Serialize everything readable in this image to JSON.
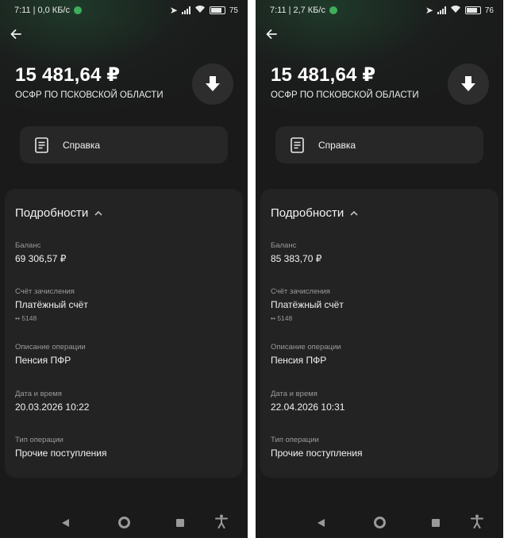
{
  "screens": [
    {
      "status": {
        "time": "7:11",
        "net": "0,0 КБ/с",
        "battery": "75"
      },
      "amount": "15 481,64 ₽",
      "payer": "ОСФР ПО ПСКОВСКОЙ ОБЛАСТИ",
      "spravka_label": "Справка",
      "details": {
        "title": "Подробности",
        "balance_label": "Баланс",
        "balance_value": "69 306,57 ₽",
        "account_label": "Счёт зачисления",
        "account_value": "Платёжный счёт",
        "account_number": "•• 5148",
        "description_label": "Описание операции",
        "description_value": "Пенсия ПФР",
        "datetime_label": "Дата и время",
        "datetime_value": "20.03.2026 10:22",
        "type_label": "Тип операции",
        "type_value": "Прочие поступления"
      }
    },
    {
      "status": {
        "time": "7:11",
        "net": "2,7 КБ/с",
        "battery": "76"
      },
      "amount": "15 481,64 ₽",
      "payer": "ОСФР ПО ПСКОВСКОЙ ОБЛАСТИ",
      "spravka_label": "Справка",
      "details": {
        "title": "Подробности",
        "balance_label": "Баланс",
        "balance_value": "85 383,70 ₽",
        "account_label": "Счёт зачисления",
        "account_value": "Платёжный счёт",
        "account_number": "•• 5148",
        "description_label": "Описание операции",
        "description_value": "Пенсия ПФР",
        "datetime_label": "Дата и время",
        "datetime_value": "22.04.2026 10:31",
        "type_label": "Тип операции",
        "type_value": "Прочие поступления"
      }
    }
  ],
  "colors": {
    "background": "#1a1a1a",
    "card": "#232323",
    "accent_green": "#3fae5a"
  },
  "icons": [
    "arrow-left-icon",
    "download-icon",
    "document-icon",
    "chevron-up-icon",
    "location-arrow-icon",
    "signal-icon",
    "wifi-icon",
    "battery-icon",
    "accessibility-icon"
  ]
}
